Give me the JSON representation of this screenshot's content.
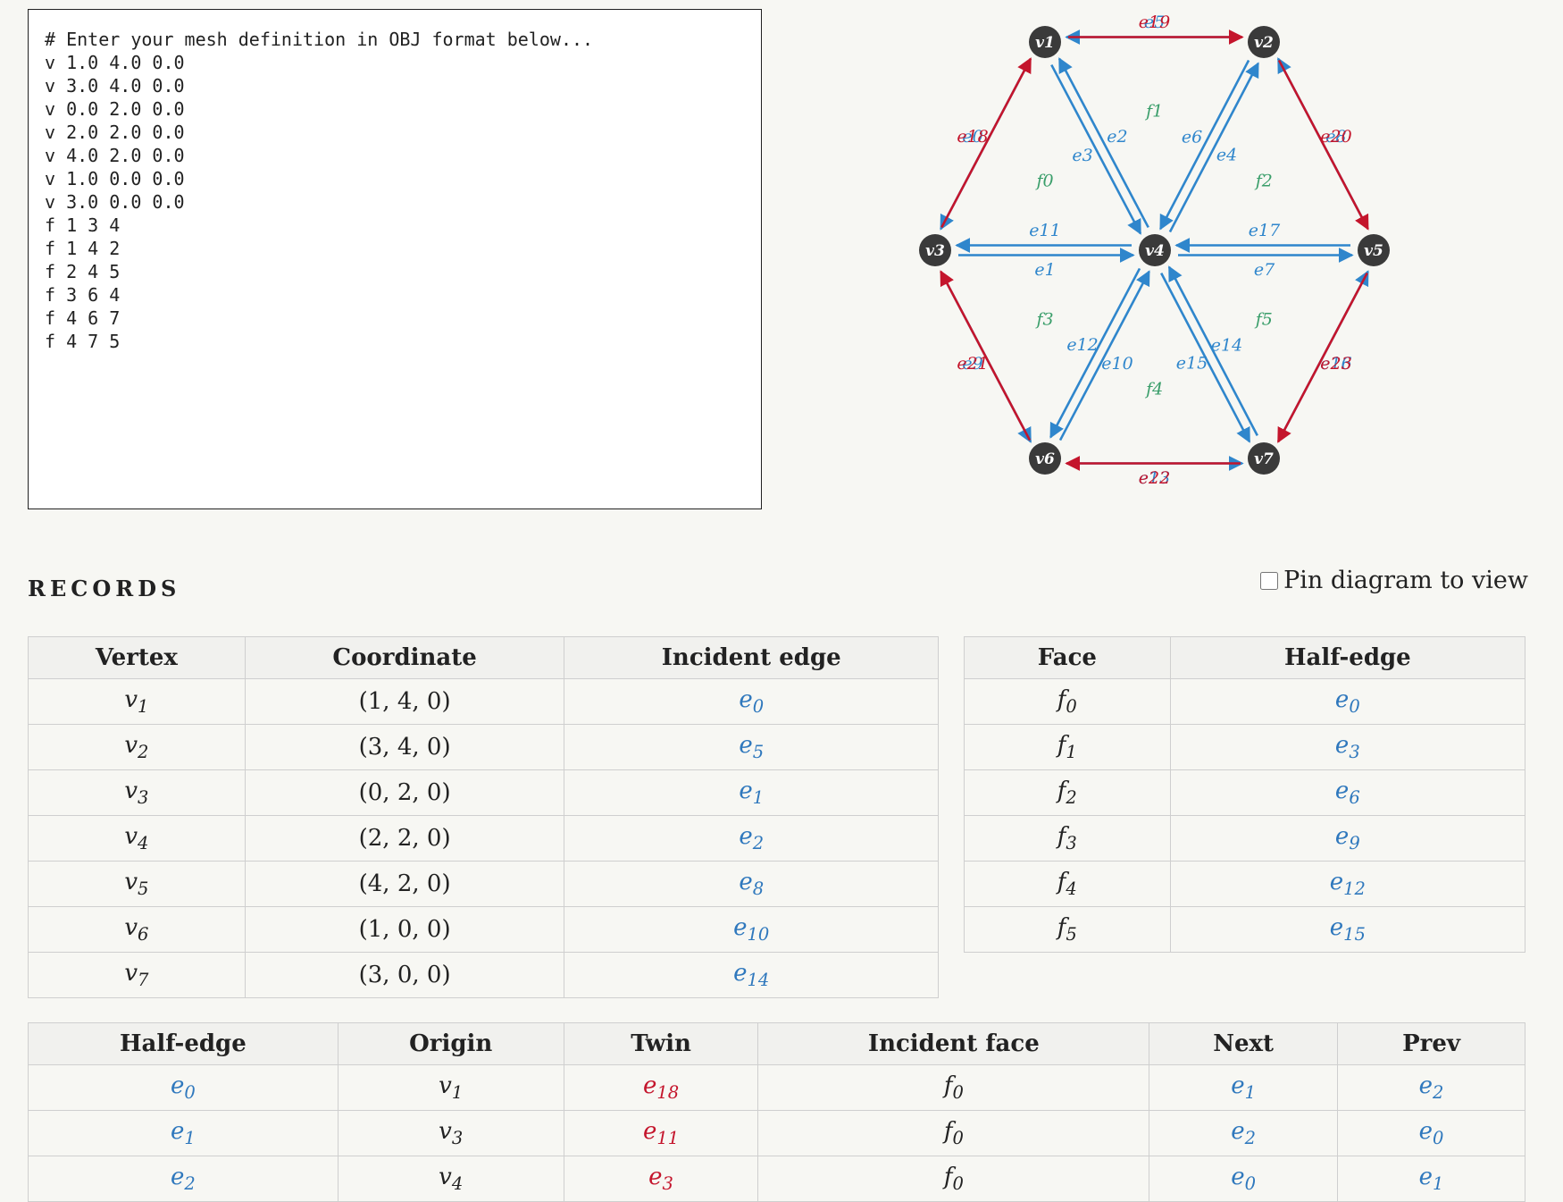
{
  "editor": {
    "text": "# Enter your mesh definition in OBJ format below...\nv 1.0 4.0 0.0\nv 3.0 4.0 0.0\nv 0.0 2.0 0.0\nv 2.0 2.0 0.0\nv 4.0 2.0 0.0\nv 1.0 0.0 0.0\nv 3.0 0.0 0.0\nf 1 3 4\nf 1 4 2\nf 2 4 5\nf 3 6 4\nf 4 6 7\nf 4 7 5"
  },
  "diagram": {
    "colors": {
      "vertex": "#3a3a3a",
      "interior": "#2f86cc",
      "boundary": "#c4152c",
      "face": "#3a9e6a"
    },
    "vertices": [
      {
        "label": "v1",
        "id": 1
      },
      {
        "label": "v2",
        "id": 2
      },
      {
        "label": "v3",
        "id": 3
      },
      {
        "label": "v4",
        "id": 4
      },
      {
        "label": "v5",
        "id": 5
      },
      {
        "label": "v6",
        "id": 6
      },
      {
        "label": "v7",
        "id": 7
      }
    ],
    "halfedges": [
      {
        "label": "e0",
        "from": 1,
        "to": 3,
        "kind": "interior"
      },
      {
        "label": "e1",
        "from": 3,
        "to": 4,
        "kind": "interior"
      },
      {
        "label": "e2",
        "from": 4,
        "to": 1,
        "kind": "interior"
      },
      {
        "label": "e3",
        "from": 1,
        "to": 4,
        "kind": "interior"
      },
      {
        "label": "e4",
        "from": 4,
        "to": 2,
        "kind": "interior"
      },
      {
        "label": "e5",
        "from": 2,
        "to": 1,
        "kind": "interior"
      },
      {
        "label": "e6",
        "from": 2,
        "to": 4,
        "kind": "interior"
      },
      {
        "label": "e7",
        "from": 4,
        "to": 5,
        "kind": "interior"
      },
      {
        "label": "e8",
        "from": 5,
        "to": 2,
        "kind": "interior"
      },
      {
        "label": "e9",
        "from": 3,
        "to": 6,
        "kind": "interior"
      },
      {
        "label": "e10",
        "from": 6,
        "to": 4,
        "kind": "interior"
      },
      {
        "label": "e11",
        "from": 4,
        "to": 3,
        "kind": "interior"
      },
      {
        "label": "e12",
        "from": 4,
        "to": 6,
        "kind": "interior"
      },
      {
        "label": "e13",
        "from": 6,
        "to": 7,
        "kind": "interior"
      },
      {
        "label": "e14",
        "from": 7,
        "to": 4,
        "kind": "interior"
      },
      {
        "label": "e15",
        "from": 4,
        "to": 7,
        "kind": "interior"
      },
      {
        "label": "e16",
        "from": 7,
        "to": 5,
        "kind": "interior"
      },
      {
        "label": "e17",
        "from": 5,
        "to": 4,
        "kind": "interior"
      },
      {
        "label": "e18",
        "from": 3,
        "to": 1,
        "kind": "boundary"
      },
      {
        "label": "e19",
        "from": 1,
        "to": 2,
        "kind": "boundary"
      },
      {
        "label": "e20",
        "from": 2,
        "to": 5,
        "kind": "boundary"
      },
      {
        "label": "e21",
        "from": 6,
        "to": 3,
        "kind": "boundary"
      },
      {
        "label": "e22",
        "from": 7,
        "to": 6,
        "kind": "boundary"
      },
      {
        "label": "e23",
        "from": 5,
        "to": 7,
        "kind": "boundary"
      }
    ],
    "faces": [
      {
        "label": "f0",
        "verts": [
          1,
          3,
          4
        ]
      },
      {
        "label": "f1",
        "verts": [
          1,
          4,
          2
        ]
      },
      {
        "label": "f2",
        "verts": [
          2,
          4,
          5
        ]
      },
      {
        "label": "f3",
        "verts": [
          3,
          6,
          4
        ]
      },
      {
        "label": "f4",
        "verts": [
          4,
          6,
          7
        ]
      },
      {
        "label": "f5",
        "verts": [
          4,
          7,
          5
        ]
      }
    ]
  },
  "records": {
    "heading": "RECORDS",
    "pin_label": "Pin diagram to view",
    "pin_checked": false
  },
  "vertex_table": {
    "headers": [
      "Vertex",
      "Coordinate",
      "Incident edge"
    ],
    "rows": [
      [
        "v1",
        "(1, 4, 0)",
        "e0"
      ],
      [
        "v2",
        "(3, 4, 0)",
        "e5"
      ],
      [
        "v3",
        "(0, 2, 0)",
        "e1"
      ],
      [
        "v4",
        "(2, 2, 0)",
        "e2"
      ],
      [
        "v5",
        "(4, 2, 0)",
        "e8"
      ],
      [
        "v6",
        "(1, 0, 0)",
        "e10"
      ],
      [
        "v7",
        "(3, 0, 0)",
        "e14"
      ]
    ]
  },
  "face_table": {
    "headers": [
      "Face",
      "Half-edge"
    ],
    "rows": [
      [
        "f0",
        "e0"
      ],
      [
        "f1",
        "e3"
      ],
      [
        "f2",
        "e6"
      ],
      [
        "f3",
        "e9"
      ],
      [
        "f4",
        "e12"
      ],
      [
        "f5",
        "e15"
      ]
    ]
  },
  "halfedge_table": {
    "headers": [
      "Half-edge",
      "Origin",
      "Twin",
      "Incident face",
      "Next",
      "Prev"
    ],
    "rows": [
      [
        "e0",
        "v1",
        "e18",
        "f0",
        "e1",
        "e2"
      ],
      [
        "e1",
        "v3",
        "e11",
        "f0",
        "e2",
        "e0"
      ],
      [
        "e2",
        "v4",
        "e3",
        "f0",
        "e0",
        "e1"
      ]
    ]
  }
}
